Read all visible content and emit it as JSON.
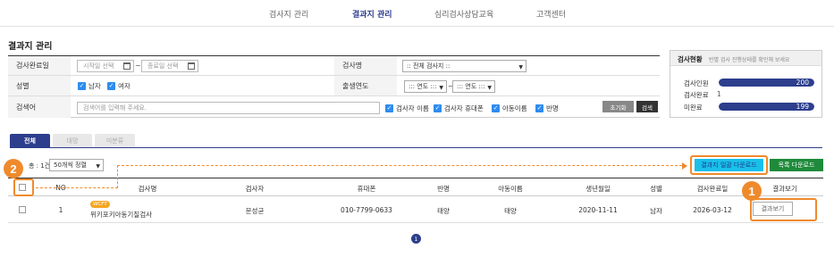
{
  "nav": {
    "items": [
      "검사지 관리",
      "결과지 관리",
      "심리검사상담교육",
      "고객센터"
    ]
  },
  "page": {
    "title": "결과지 관리"
  },
  "filters": {
    "date_label": "검사완료일",
    "start_placeholder": "시작일 선택",
    "end_placeholder": "종료일 선택",
    "date_sep": "~",
    "test_label": "검사명",
    "test_selected": ":: 전체 검사지 ::",
    "gender_label": "성별",
    "gender_options": [
      "남자",
      "여자"
    ],
    "birth_label": "출생연도",
    "year_from": "::: 연도 :::",
    "year_sep": "~",
    "year_to": "::: 연도 :::",
    "keyword_label": "검색어",
    "keyword_placeholder": "검색어를 입력해 주세요.",
    "keyword_options": [
      "검사자 이름",
      "검사자 휴대폰",
      "아동이름",
      "반명"
    ],
    "reset_label": "초기화",
    "search_label": "검색"
  },
  "stats": {
    "title": "검사현황",
    "subtitle": "반별 검사 진행상태를 확인해 보세요",
    "items": [
      {
        "label": "검사인원",
        "value": "200",
        "fill": 1.0
      },
      {
        "label": "검사완료",
        "value": "1"
      },
      {
        "label": "미완료",
        "value": "199",
        "fill": 1.0
      }
    ]
  },
  "tabs": [
    "전체",
    "대망",
    "미분류"
  ],
  "list": {
    "count": "총 : 1건",
    "page_size": "50개씩 정렬",
    "excel_button": "결과지 일괄 다운로드",
    "list_button": "목록 다운로드",
    "columns": [
      "NO",
      "검사명",
      "검사자",
      "휴대폰",
      "반명",
      "아동이름",
      "생년월일",
      "성별",
      "검사완료일",
      "결과보기"
    ],
    "rows": [
      {
        "no": "1",
        "badge": "WCFT",
        "test_name": "위키포키아동기질검사",
        "examiner": "문성균",
        "phone": "010-7799-0633",
        "class_name": "태양",
        "child": "태양",
        "birth": "2020-11-11",
        "gender": "남자",
        "done_date": "2026-03-12",
        "view_label": "결과보기"
      }
    ]
  },
  "pagination": {
    "current": "1"
  },
  "callouts": [
    "1",
    "2"
  ],
  "colors": {
    "primary": "#2c3e8c",
    "accent_orange": "#ef8a2c",
    "excel_button": "#19c0ea",
    "list_button": "#1e8a3a",
    "checkbox_blue": "#2e8cf0"
  }
}
